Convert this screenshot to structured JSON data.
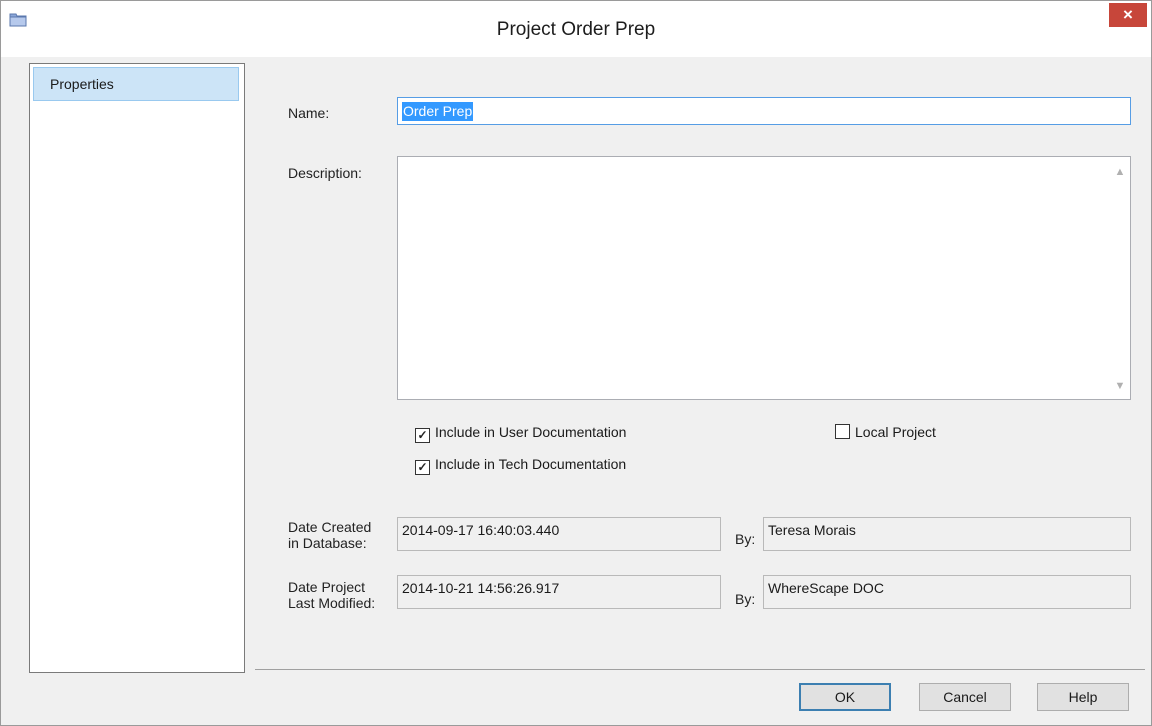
{
  "window": {
    "title": "Project Order Prep",
    "icon": "folder-icon",
    "close_glyph": "×"
  },
  "nav": {
    "items": [
      {
        "label": "Properties",
        "selected": true
      }
    ]
  },
  "form": {
    "name_label": "Name:",
    "name_value": "Order Prep",
    "description_label": "Description:",
    "description_value": "",
    "include_user_doc": {
      "label": "Include in User Documentation",
      "checked": true
    },
    "include_tech_doc": {
      "label": "Include in Tech Documentation",
      "checked": true
    },
    "local_project": {
      "label": "Local Project",
      "checked": false
    },
    "date_created_label_1": "Date Created",
    "date_created_label_2": "in Database:",
    "date_created_value": "2014-09-17 16:40:03.440",
    "created_by_label": "By:",
    "created_by_value": "Teresa Morais",
    "date_modified_label_1": "Date Project",
    "date_modified_label_2": "Last Modified:",
    "date_modified_value": "2014-10-21 14:56:26.917",
    "modified_by_label": "By:",
    "modified_by_value": "WhereScape DOC"
  },
  "buttons": {
    "ok": "OK",
    "cancel": "Cancel",
    "help": "Help"
  },
  "colors": {
    "accent": "#3399ff",
    "close": "#c7463a",
    "selection_bg": "#cce4f7"
  }
}
